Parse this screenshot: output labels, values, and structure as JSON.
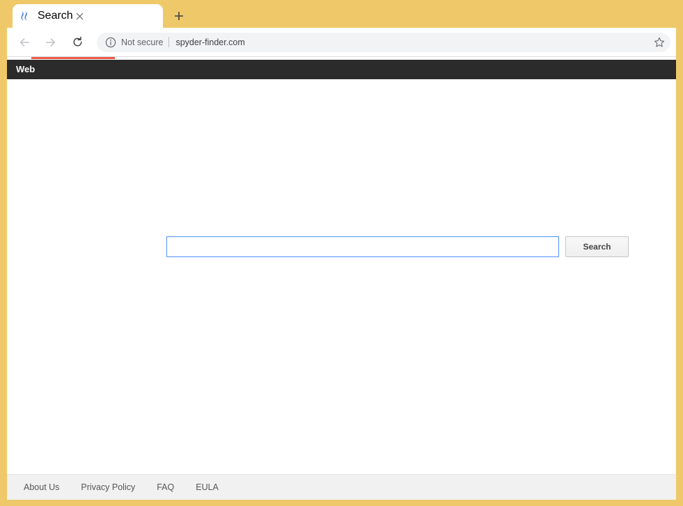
{
  "browser": {
    "tab": {
      "title": "Search",
      "favicon_icon": "spyder-finder-logo-icon",
      "close_icon": "close-icon"
    },
    "new_tab_icon": "plus-icon",
    "toolbar": {
      "back_icon": "arrow-left-icon",
      "forward_icon": "arrow-right-icon",
      "reload_icon": "reload-icon",
      "security_icon": "info-circle-icon",
      "security_status": "Not secure",
      "url": "spyder-finder.com",
      "bookmark_icon": "star-icon"
    }
  },
  "site": {
    "navbar": {
      "items": [
        {
          "label": "Web"
        }
      ]
    },
    "search": {
      "value": "",
      "placeholder": "",
      "button_label": "Search"
    },
    "footer": {
      "links": [
        {
          "label": "About Us"
        },
        {
          "label": "Privacy Policy"
        },
        {
          "label": "FAQ"
        },
        {
          "label": "EULA"
        }
      ]
    }
  },
  "colors": {
    "frame_yellow": "#efc969",
    "navbar_dark": "#2b2b2b",
    "progress_red": "#ea5a47",
    "input_border_blue": "#4d90fe",
    "footer_gray": "#f1f1f1"
  }
}
